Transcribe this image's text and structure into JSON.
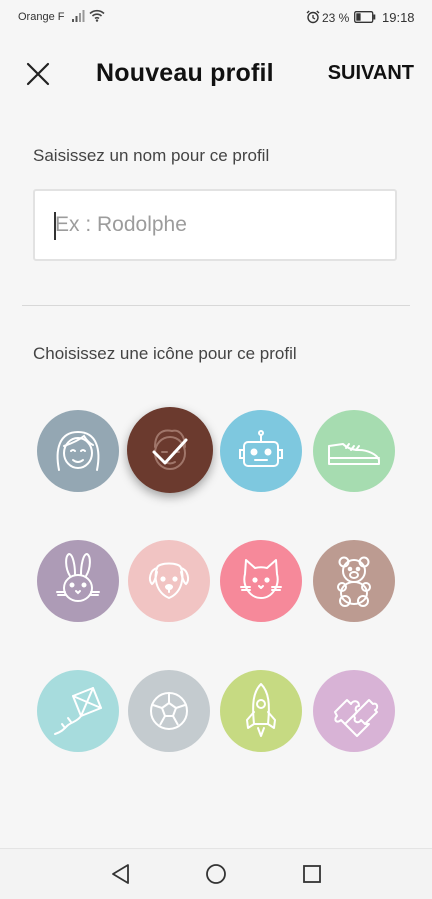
{
  "status_bar": {
    "carrier": "Orange F",
    "battery_percent": "23 %",
    "time": "19:18"
  },
  "header": {
    "title": "Nouveau profil",
    "next_label": "SUIVANT"
  },
  "name_section": {
    "label": "Saisissez un nom pour ce profil",
    "input_value": "",
    "input_placeholder": "Ex : Rodolphe"
  },
  "icon_section": {
    "label": "Choisissez une icône pour ce profil",
    "selected_index": 1,
    "icons": [
      {
        "name": "girl",
        "color": "#94a7b3"
      },
      {
        "name": "boy",
        "color": "#6b3a2e"
      },
      {
        "name": "robot",
        "color": "#7ec8df"
      },
      {
        "name": "sneaker",
        "color": "#a6dcb0"
      },
      {
        "name": "rabbit",
        "color": "#ad9bb6"
      },
      {
        "name": "dog",
        "color": "#f1c4c3"
      },
      {
        "name": "cat",
        "color": "#f6899a"
      },
      {
        "name": "teddy-bear",
        "color": "#bc9b91"
      },
      {
        "name": "kite",
        "color": "#a7dcdd"
      },
      {
        "name": "soccer-ball",
        "color": "#c4cbcf"
      },
      {
        "name": "rocket",
        "color": "#c6da82"
      },
      {
        "name": "puzzle",
        "color": "#d8b3d6"
      }
    ]
  },
  "nav_bar": {
    "buttons": [
      "back",
      "home",
      "recents"
    ]
  }
}
